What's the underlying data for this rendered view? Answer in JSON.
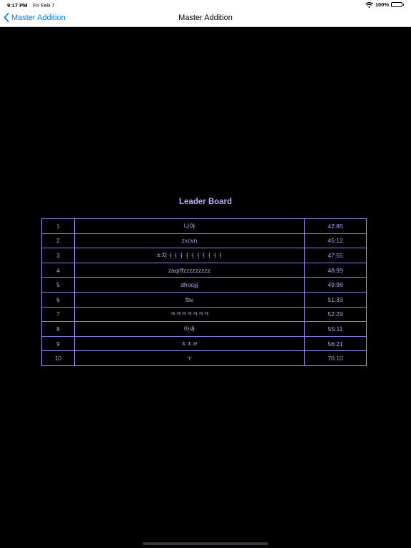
{
  "status_bar": {
    "time": "9:17 PM",
    "date": "Fri Feb 7",
    "battery": "100%"
  },
  "nav": {
    "back_label": "Master Addition",
    "title": "Master Addition"
  },
  "leaderboard": {
    "title": "Leader Board",
    "rows": [
      {
        "rank": "1",
        "name": "나야",
        "time": "42:85"
      },
      {
        "rank": "2",
        "name": "zxcvn",
        "time": "45:12"
      },
      {
        "rank": "3",
        "name": "ㅊ처ㅓㅓㅓㅓㅓㅓㅓㅓㅓㅓ",
        "time": "47:55"
      },
      {
        "rank": "4",
        "name": "zaqrffzzzzzzzzz",
        "time": "48:99"
      },
      {
        "rank": "5",
        "name": "dhoojjj",
        "time": "49:98"
      },
      {
        "rank": "6",
        "name": "fbv",
        "time": "51:33"
      },
      {
        "rank": "7",
        "name": "ㅋㅋㅋㅋㅋㅋㅋ",
        "time": "52:29"
      },
      {
        "rank": "8",
        "name": "아싸",
        "time": "55:11"
      },
      {
        "rank": "9",
        "name": "ㅊㅊㄹ",
        "time": "56:21"
      },
      {
        "rank": "10",
        "name": "ㅜ",
        "time": "70:10"
      }
    ]
  },
  "colors": {
    "accent": "#0a7aff",
    "table_border": "#8c82e8",
    "table_text": "#a9a3e8",
    "title_text": "#b4aef2",
    "background": "#000000"
  }
}
